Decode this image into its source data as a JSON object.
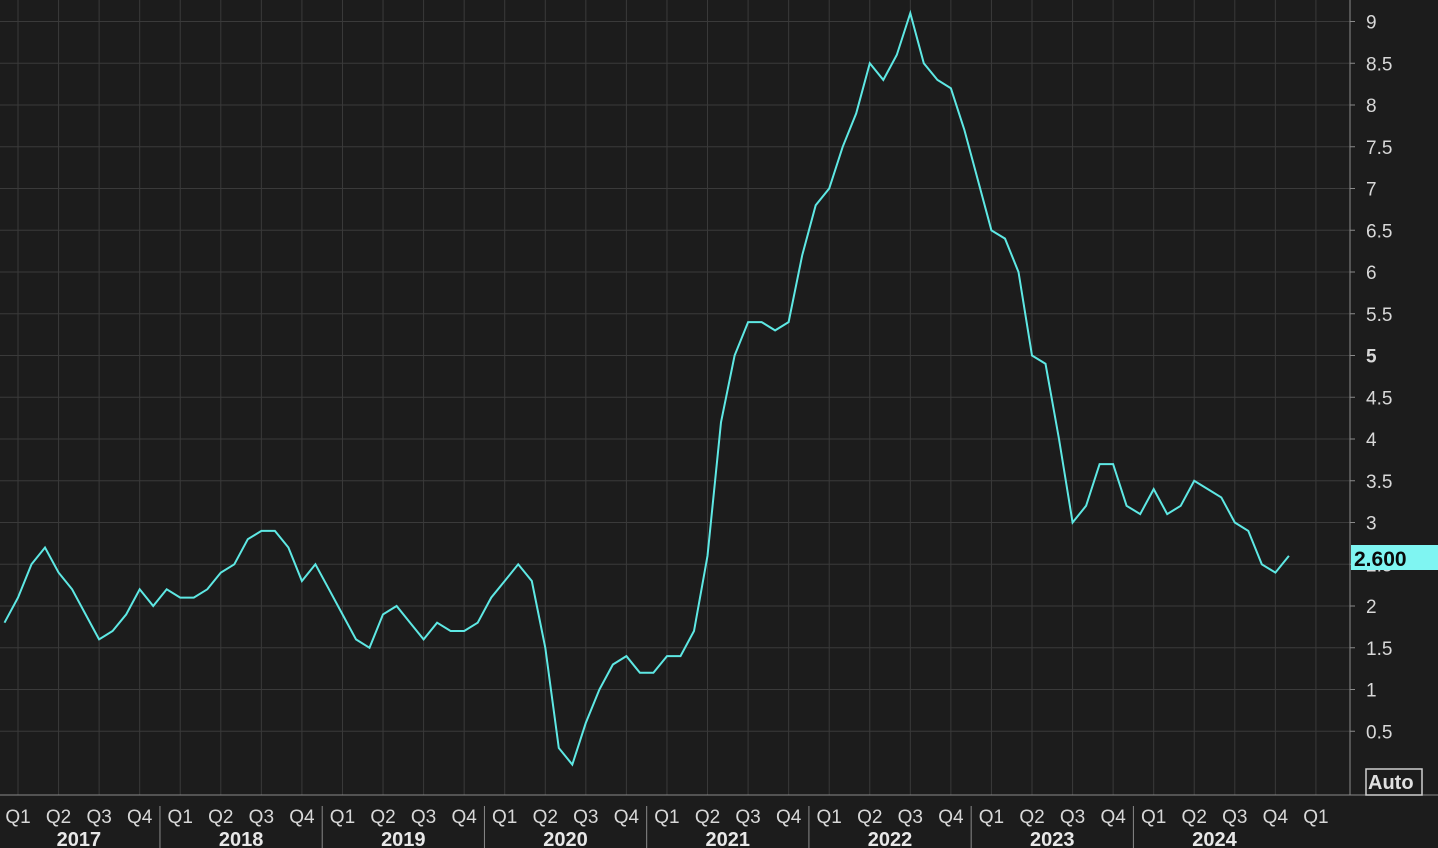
{
  "chart_data": {
    "type": "line",
    "title": "",
    "xlabel": "",
    "ylabel": "",
    "ylim": [
      0,
      9.2
    ],
    "y_ticks": [
      "0.5",
      "1",
      "1.5",
      "2",
      "2.5",
      "3",
      "3.5",
      "4",
      "4.5",
      "5",
      "5.5",
      "6",
      "6.5",
      "7",
      "7.5",
      "8",
      "8.5",
      "9"
    ],
    "x_quarter_labels": [
      "Q1",
      "Q2",
      "Q3",
      "Q4",
      "Q1",
      "Q2",
      "Q3",
      "Q4",
      "Q1",
      "Q2",
      "Q3",
      "Q4",
      "Q1",
      "Q2",
      "Q3",
      "Q4",
      "Q1",
      "Q2",
      "Q3",
      "Q4",
      "Q1",
      "Q2",
      "Q3",
      "Q4",
      "Q1",
      "Q2",
      "Q3",
      "Q4",
      "Q1",
      "Q2",
      "Q3",
      "Q4",
      "Q1"
    ],
    "x_year_labels": [
      "2017",
      "2018",
      "2019",
      "2020",
      "2021",
      "2022",
      "2023",
      "2024"
    ],
    "grid": true,
    "last_value_label": "2.600",
    "auto_button_label": "Auto",
    "series_color": "#5ee8e4",
    "series": [
      {
        "x": [
          "2016-12",
          "2017-01",
          "2017-02",
          "2017-03",
          "2017-04",
          "2017-05",
          "2017-06",
          "2017-07",
          "2017-08",
          "2017-09",
          "2017-10",
          "2017-11",
          "2017-12",
          "2018-01",
          "2018-02",
          "2018-03",
          "2018-04",
          "2018-05",
          "2018-06",
          "2018-07",
          "2018-08",
          "2018-09",
          "2018-10",
          "2018-11",
          "2018-12",
          "2019-01",
          "2019-02",
          "2019-03",
          "2019-04",
          "2019-05",
          "2019-06",
          "2019-07",
          "2019-08",
          "2019-09",
          "2019-10",
          "2019-11",
          "2019-12",
          "2020-01",
          "2020-02",
          "2020-03",
          "2020-04",
          "2020-05",
          "2020-06",
          "2020-07",
          "2020-08",
          "2020-09",
          "2020-10",
          "2020-11",
          "2020-12",
          "2021-01",
          "2021-02",
          "2021-03",
          "2021-04",
          "2021-05",
          "2021-06",
          "2021-07",
          "2021-08",
          "2021-09",
          "2021-10",
          "2021-11",
          "2021-12",
          "2022-01",
          "2022-02",
          "2022-03",
          "2022-04",
          "2022-05",
          "2022-06",
          "2022-07",
          "2022-08",
          "2022-09",
          "2022-10",
          "2022-11",
          "2022-12",
          "2023-01",
          "2023-02",
          "2023-03",
          "2023-04",
          "2023-05",
          "2023-06",
          "2023-07",
          "2023-08",
          "2023-09",
          "2023-10",
          "2023-11",
          "2023-12",
          "2024-01",
          "2024-02",
          "2024-03",
          "2024-04",
          "2024-05",
          "2024-06",
          "2024-07",
          "2024-08",
          "2024-09",
          "2024-10",
          "2024-11"
        ],
        "values": [
          1.8,
          2.1,
          2.5,
          2.7,
          2.4,
          2.2,
          1.9,
          1.6,
          1.7,
          1.9,
          2.2,
          2.0,
          2.2,
          2.1,
          2.1,
          2.2,
          2.4,
          2.5,
          2.8,
          2.9,
          2.9,
          2.7,
          2.3,
          2.5,
          2.2,
          1.9,
          1.6,
          1.5,
          1.9,
          2.0,
          1.8,
          1.6,
          1.8,
          1.7,
          1.7,
          1.8,
          2.1,
          2.3,
          2.5,
          2.3,
          1.5,
          0.3,
          0.1,
          0.6,
          1.0,
          1.3,
          1.4,
          1.2,
          1.2,
          1.4,
          1.4,
          1.7,
          2.6,
          4.2,
          5.0,
          5.4,
          5.4,
          5.3,
          5.4,
          6.2,
          6.8,
          7.0,
          7.5,
          7.9,
          8.5,
          8.3,
          8.6,
          9.1,
          8.5,
          8.3,
          8.2,
          7.7,
          7.1,
          6.5,
          6.4,
          6.0,
          5.0,
          4.9,
          4.0,
          3.0,
          3.2,
          3.7,
          3.7,
          3.2,
          3.1,
          3.4,
          3.1,
          3.2,
          3.5,
          3.4,
          3.3,
          3.0,
          2.9,
          2.5,
          2.4,
          2.6
        ]
      }
    ]
  }
}
